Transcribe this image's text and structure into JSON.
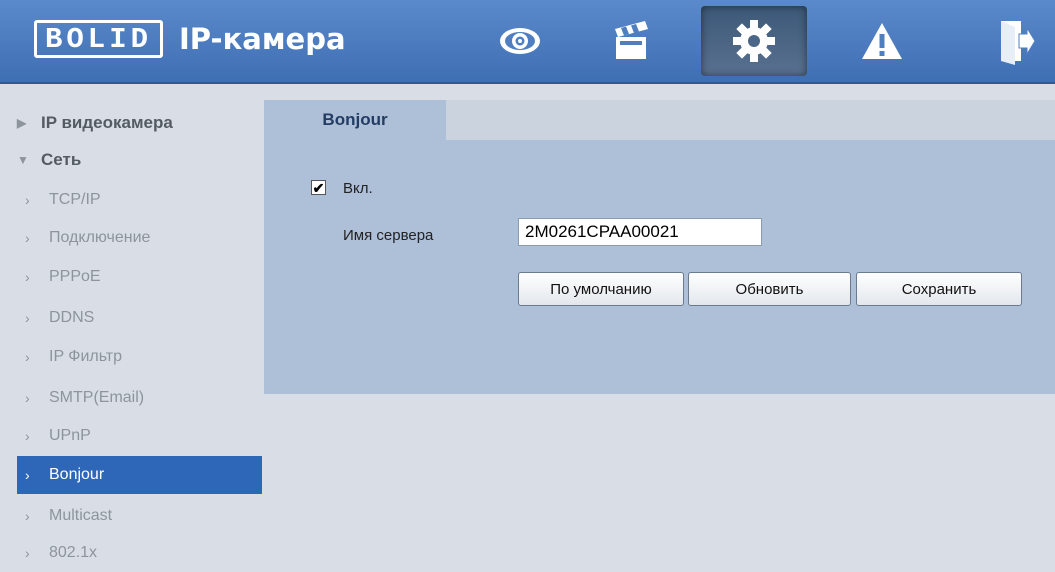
{
  "header": {
    "logo_text": "BOLID",
    "title": "IP-камера",
    "nav": [
      {
        "icon": "eye-icon"
      },
      {
        "icon": "clapperboard-icon"
      },
      {
        "icon": "gear-icon"
      },
      {
        "icon": "warning-icon"
      },
      {
        "icon": "logout-icon"
      }
    ],
    "active_nav": "gear-icon"
  },
  "sidebar": {
    "groups": [
      {
        "label": "IP видеокамера",
        "expanded": false
      },
      {
        "label": "Сеть",
        "expanded": true
      }
    ],
    "items": [
      {
        "label": "TCP/IP"
      },
      {
        "label": "Подключение"
      },
      {
        "label": "PPPoE"
      },
      {
        "label": "DDNS"
      },
      {
        "label": "IP Фильтр"
      },
      {
        "label": "SMTP(Email)"
      },
      {
        "label": "UPnP"
      },
      {
        "label": "Bonjour",
        "selected": true
      },
      {
        "label": "Multicast"
      },
      {
        "label": "802.1x"
      }
    ]
  },
  "main": {
    "tab_label": "Bonjour",
    "enable_label": "Вкл.",
    "enable_checked": true,
    "server_name_label": "Имя сервера",
    "server_name_value": "2M0261CPAA00021",
    "buttons": {
      "default": "По умолчанию",
      "refresh": "Обновить",
      "save": "Сохранить"
    }
  },
  "colors": {
    "header": "#4f7fc1",
    "selected": "#2f67b8",
    "panel": "#aebfd8",
    "background": "#d9dee6"
  }
}
